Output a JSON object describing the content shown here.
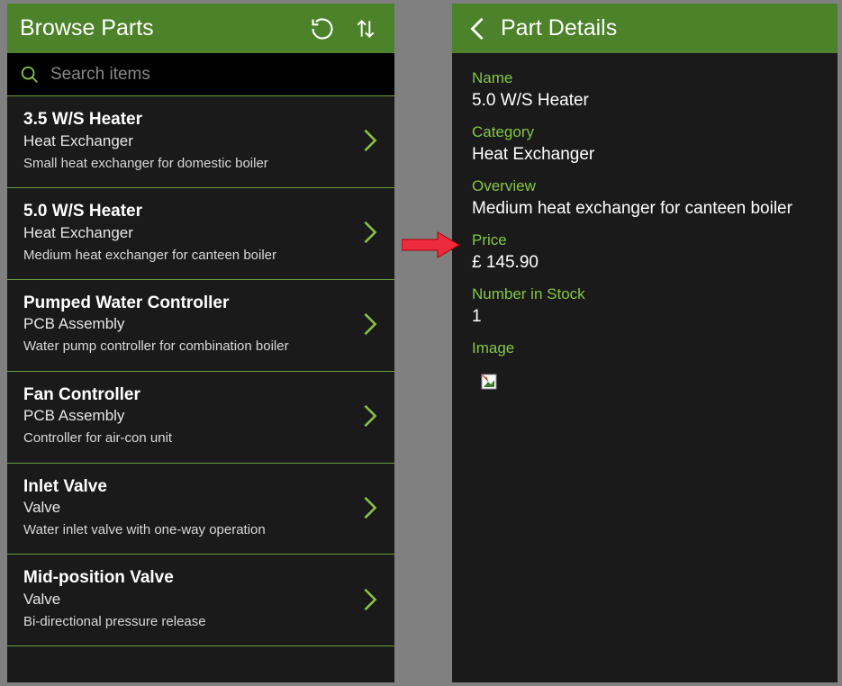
{
  "browse": {
    "title": "Browse Parts",
    "search_placeholder": "Search items",
    "items": [
      {
        "name": "3.5 W/S Heater",
        "category": "Heat Exchanger",
        "desc": "Small heat exchanger for domestic boiler"
      },
      {
        "name": "5.0 W/S Heater",
        "category": "Heat Exchanger",
        "desc": "Medium  heat exchanger for canteen boiler"
      },
      {
        "name": "Pumped Water Controller",
        "category": "PCB Assembly",
        "desc": "Water pump controller for combination boiler"
      },
      {
        "name": "Fan Controller",
        "category": "PCB Assembly",
        "desc": "Controller for air-con unit"
      },
      {
        "name": "Inlet Valve",
        "category": "Valve",
        "desc": "Water inlet valve with one-way operation"
      },
      {
        "name": "Mid-position Valve",
        "category": "Valve",
        "desc": "Bi-directional pressure release"
      }
    ]
  },
  "details": {
    "title": "Part Details",
    "labels": {
      "name": "Name",
      "category": "Category",
      "overview": "Overview",
      "price": "Price",
      "stock": "Number in Stock",
      "image": "Image"
    },
    "values": {
      "name": "5.0 W/S Heater",
      "category": "Heat Exchanger",
      "overview": "Medium  heat exchanger for canteen boiler",
      "price": "£ 145.90",
      "stock": "1"
    }
  }
}
